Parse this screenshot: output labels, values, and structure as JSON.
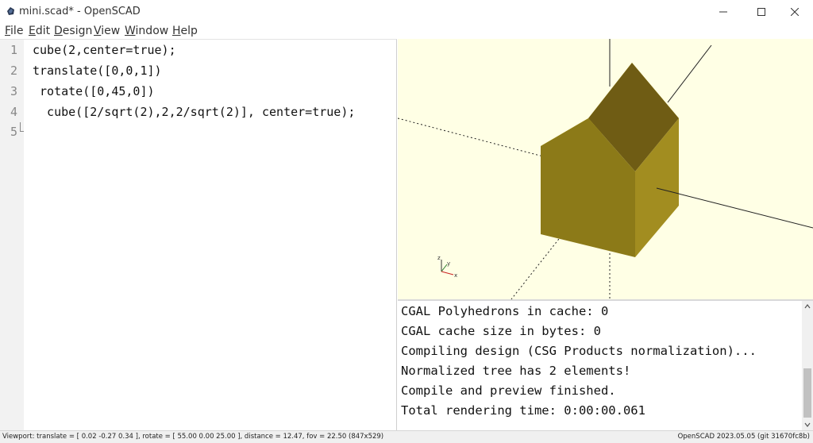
{
  "window": {
    "title": "mini.scad* - OpenSCAD"
  },
  "menu": [
    "File",
    "Edit",
    "Design",
    "View",
    "Window",
    "Help"
  ],
  "editor": {
    "lines": [
      "cube(2,center=true);",
      "translate([0,0,1])",
      " rotate([0,45,0])",
      "  cube([2/sqrt(2),2,2/sqrt(2)], center=true);",
      ""
    ],
    "line_numbers": [
      "1",
      "2",
      "3",
      "4",
      "5"
    ]
  },
  "viewport": {
    "background_color": "#ffffe5",
    "axis_labels": [
      "z",
      "y",
      "x"
    ],
    "colors": {
      "top_face": "#f5e639",
      "roof_face": "#6f5c14",
      "front_face": "#8c7a18",
      "right_face": "#a28d20"
    }
  },
  "console": {
    "lines": [
      "CGAL Polyhedrons in cache: 0",
      "CGAL cache size in bytes: 0",
      "Compiling design (CSG Products normalization)...",
      "Normalized tree has 2 elements!",
      "Compile and preview finished.",
      "Total rendering time: 0:00:00.061"
    ]
  },
  "statusbar": {
    "viewport_info": "Viewport: translate = [ 0.02 -0.27 0.34 ], rotate = [ 55.00 0.00 25.00 ], distance = 12.47, fov = 22.50 (847x529)",
    "version": "OpenSCAD 2023.05.05 (git 31670fc8b)"
  }
}
